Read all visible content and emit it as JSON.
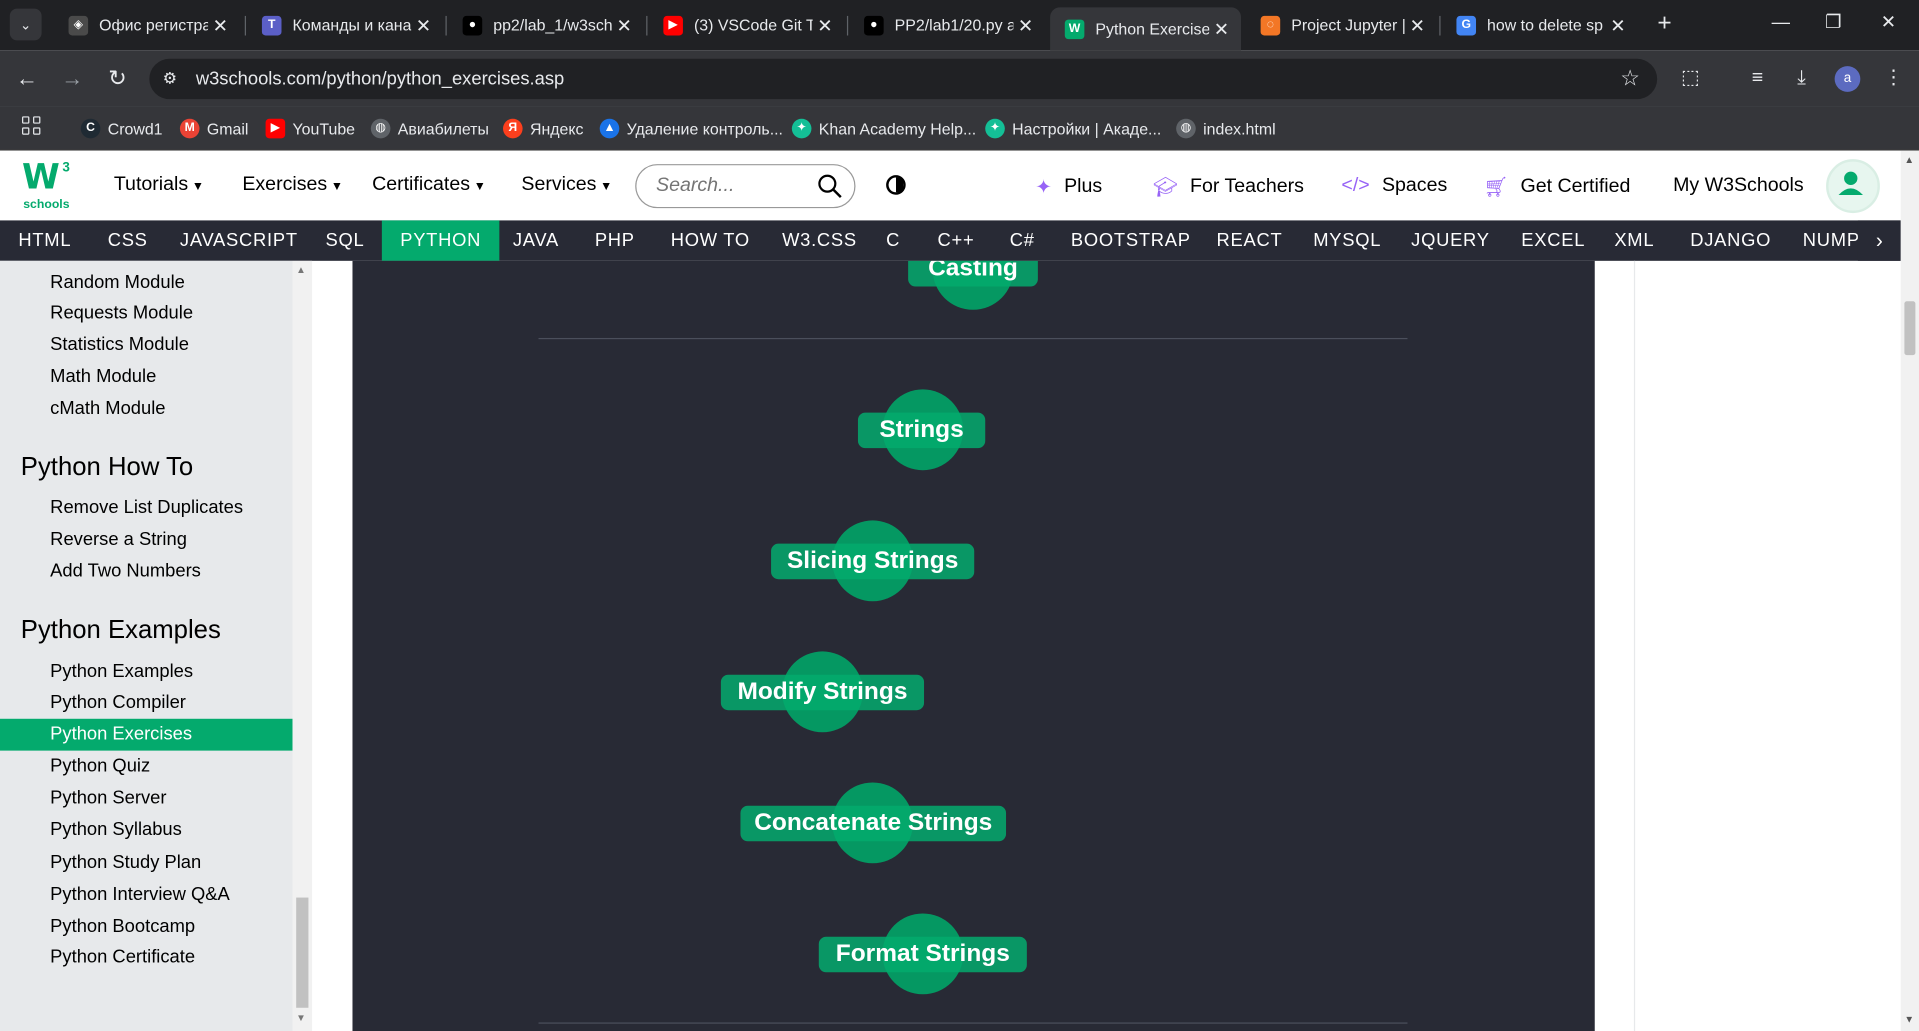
{
  "browser": {
    "tabs": [
      {
        "title": "Офис регистрат",
        "favicon_color": "#4a4a4a",
        "favicon_glyph": "◈"
      },
      {
        "title": "Команды и кана",
        "favicon_color": "#5b5fc7",
        "favicon_glyph": "T"
      },
      {
        "title": "pp2/lab_1/w3sch",
        "favicon_color": "#000000",
        "favicon_glyph": "●"
      },
      {
        "title": "(3) VSCode Git T",
        "favicon_color": "#ff0000",
        "favicon_glyph": "▶"
      },
      {
        "title": "PP2/lab1/20.py a",
        "favicon_color": "#000000",
        "favicon_glyph": "●"
      },
      {
        "title": "Python Exercises",
        "favicon_color": "#04aa6d",
        "favicon_glyph": "W",
        "active": true
      },
      {
        "title": "Project Jupyter |",
        "favicon_color": "#f37726",
        "favicon_glyph": "◌"
      },
      {
        "title": "how to delete sp",
        "favicon_color": "#4285f4",
        "favicon_glyph": "G"
      }
    ],
    "url": "w3schools.com/python/python_exercises.asp",
    "bookmarks": [
      {
        "label": "Crowd1",
        "color": "#1f2a33",
        "glyph": "C"
      },
      {
        "label": "Gmail",
        "color": "#ea4335",
        "glyph": "M"
      },
      {
        "label": "YouTube",
        "color": "#ff0000",
        "glyph": "▶"
      },
      {
        "label": "Авиабилеты",
        "color": "#5f6368",
        "glyph": "◍"
      },
      {
        "label": "Яндекс",
        "color": "#fc3f1d",
        "glyph": "Я"
      },
      {
        "label": "Удаление контроль...",
        "color": "#1a73e8",
        "glyph": "▲"
      },
      {
        "label": "Khan Academy Help...",
        "color": "#14bf96",
        "glyph": "✦"
      },
      {
        "label": "Настройки | Акаде...",
        "color": "#14bf96",
        "glyph": "✦"
      },
      {
        "label": "index.html",
        "color": "#5f6368",
        "glyph": "◍"
      }
    ]
  },
  "w3": {
    "logo_schools": "schools",
    "logo_sup": "3",
    "nav": {
      "tutorials": "Tutorials",
      "exercises": "Exercises",
      "certificates": "Certificates",
      "services": "Services"
    },
    "search_placeholder": "Search...",
    "right_nav": {
      "plus": "Plus",
      "teachers": "For Teachers",
      "spaces": "Spaces",
      "certified": "Get Certified",
      "my": "My W3Schools"
    },
    "languages": [
      "HTML",
      "CSS",
      "JAVASCRIPT",
      "SQL",
      "PYTHON",
      "JAVA",
      "PHP",
      "HOW TO",
      "W3.CSS",
      "C",
      "C++",
      "C#",
      "BOOTSTRAP",
      "REACT",
      "MYSQL",
      "JQUERY",
      "EXCEL",
      "XML",
      "DJANGO",
      "NUMPY"
    ],
    "active_language": "PYTHON",
    "brand_color": "#04aa6d",
    "dark_color": "#282a35"
  },
  "sidebar": {
    "modules": [
      "Random Module",
      "Requests Module",
      "Statistics Module",
      "Math Module",
      "cMath Module"
    ],
    "howto_heading": "Python How To",
    "howto": [
      "Remove List Duplicates",
      "Reverse a String",
      "Add Two Numbers"
    ],
    "examples_heading": "Python Examples",
    "examples": [
      "Python Examples",
      "Python Compiler",
      "Python Exercises",
      "Python Quiz",
      "Python Server",
      "Python Syllabus",
      "Python Study Plan",
      "Python Interview Q&A",
      "Python Bootcamp",
      "Python Certificate"
    ],
    "active_item": "Python Exercises"
  },
  "main": {
    "nodes": [
      "Casting",
      "Strings",
      "Slicing Strings",
      "Modify Strings",
      "Concatenate Strings",
      "Format Strings"
    ]
  }
}
